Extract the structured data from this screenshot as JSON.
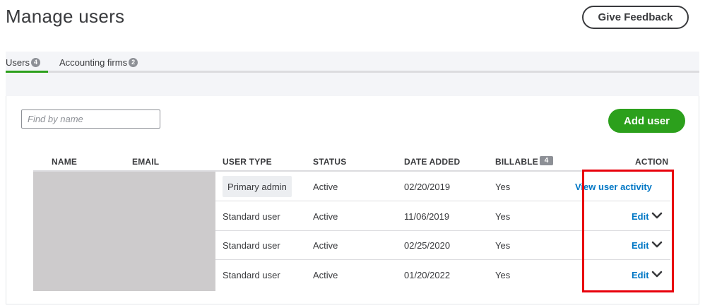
{
  "page": {
    "title": "Manage users"
  },
  "header": {
    "feedback_label": "Give Feedback"
  },
  "tabs": [
    {
      "label": "Users",
      "count": "4",
      "active": true
    },
    {
      "label": "Accounting firms",
      "count": "2",
      "active": false
    }
  ],
  "toolbar": {
    "search_placeholder": "Find by name",
    "search_value": "",
    "add_label": "Add user"
  },
  "table": {
    "columns": {
      "name": "NAME",
      "email": "EMAIL",
      "user_type": "USER TYPE",
      "status": "STATUS",
      "date_added": "DATE ADDED",
      "billable": "BILLABLE",
      "billable_count": "4",
      "action": "ACTION"
    },
    "rows": [
      {
        "user_type": "Primary admin",
        "status": "Active",
        "date_added": "02/20/2019",
        "billable": "Yes",
        "action": "View user activity"
      },
      {
        "user_type": "Standard user",
        "status": "Active",
        "date_added": "11/06/2019",
        "billable": "Yes",
        "action": "Edit"
      },
      {
        "user_type": "Standard user",
        "status": "Active",
        "date_added": "02/25/2020",
        "billable": "Yes",
        "action": "Edit"
      },
      {
        "user_type": "Standard user",
        "status": "Active",
        "date_added": "01/20/2022",
        "billable": "Yes",
        "action": "Edit"
      }
    ]
  },
  "icons": {
    "row_menu": "chevron-down-icon"
  },
  "colors": {
    "primary_green": "#2ca01c",
    "link_blue": "#0077c5",
    "highlight_red": "#e8000b",
    "text": "#393a3d"
  }
}
